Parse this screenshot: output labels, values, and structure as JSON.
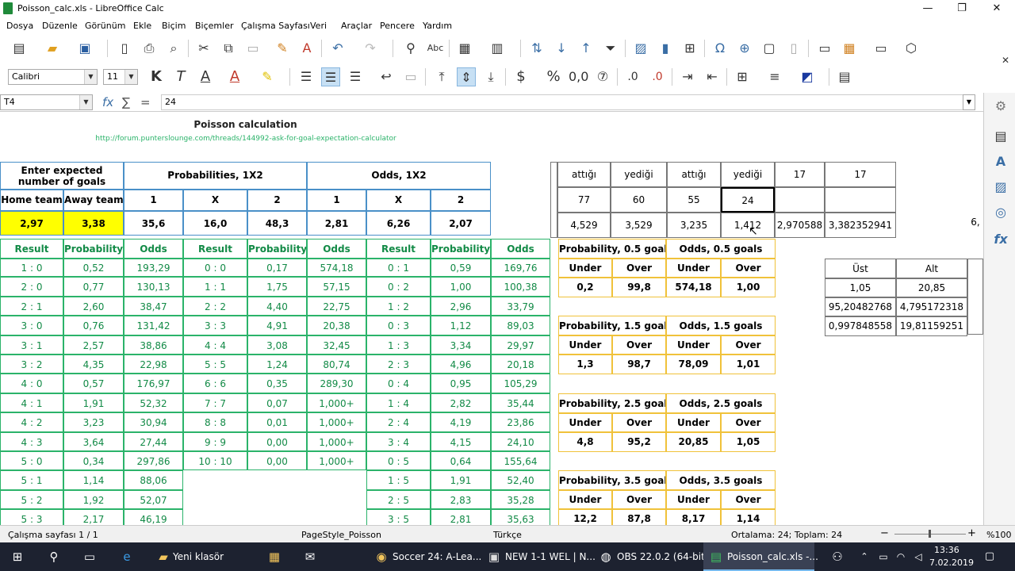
{
  "window": {
    "title": "Poisson_calc.xls - LibreOffice Calc",
    "min": "—",
    "max": "❐",
    "close": "✕"
  },
  "menu": [
    "Dosya",
    "Düzenle",
    "Görünüm",
    "Ekle",
    "Biçim",
    "Biçemler",
    "Çalışma Sayfası",
    "Veri",
    "Araçlar",
    "Pencere",
    "Yardım"
  ],
  "toolbar": {
    "font_name": "Calibri",
    "font_size": "11"
  },
  "formula": {
    "cell_ref": "T4",
    "fx": "fx",
    "sigma": "∑",
    "equals": "=",
    "content": "24"
  },
  "sheet": {
    "title": "Poisson calculation",
    "link": "http://forum.punterslounge.com/threads/144992-ask-for-goal-expectation-calculator",
    "hdr_expected": "Enter expected number of goals",
    "hdr_probs": "Probabilities, 1X2",
    "hdr_odds": "Odds, 1X2",
    "home_team": "Home team",
    "away_team": "Away team",
    "col_1": "1",
    "col_x": "X",
    "col_2": "2",
    "home_val": "2,97",
    "away_val": "3,38",
    "p1": "35,6",
    "px": "16,0",
    "p2": "48,3",
    "o1": "2,81",
    "ox": "6,26",
    "o2": "2,07",
    "col_result": "Result",
    "col_probability": "Probability",
    "col_odds": "Odds",
    "table_a": [
      [
        "1  :  0",
        "0,52",
        "193,29"
      ],
      [
        "2  :  0",
        "0,77",
        "130,13"
      ],
      [
        "2  :  1",
        "2,60",
        "38,47"
      ],
      [
        "3  :  0",
        "0,76",
        "131,42"
      ],
      [
        "3  :  1",
        "2,57",
        "38,86"
      ],
      [
        "3  :  2",
        "4,35",
        "22,98"
      ],
      [
        "4  :  0",
        "0,57",
        "176,97"
      ],
      [
        "4  :  1",
        "1,91",
        "52,32"
      ],
      [
        "4  :  2",
        "3,23",
        "30,94"
      ],
      [
        "4  :  3",
        "3,64",
        "27,44"
      ],
      [
        "5  :  0",
        "0,34",
        "297,86"
      ],
      [
        "5  :  1",
        "1,14",
        "88,06"
      ],
      [
        "5  :  2",
        "1,92",
        "52,07"
      ],
      [
        "5  :  3",
        "2,17",
        "46,19"
      ]
    ],
    "table_b": [
      [
        "0  :  0",
        "0,17",
        "574,18"
      ],
      [
        "1  :  1",
        "1,75",
        "57,15"
      ],
      [
        "2  :  2",
        "4,40",
        "22,75"
      ],
      [
        "3  :  3",
        "4,91",
        "20,38"
      ],
      [
        "4  :  4",
        "3,08",
        "32,45"
      ],
      [
        "5  :  5",
        "1,24",
        "80,74"
      ],
      [
        "6  :  6",
        "0,35",
        "289,30"
      ],
      [
        "7  :  7",
        "0,07",
        "1,000+"
      ],
      [
        "8  :  8",
        "0,01",
        "1,000+"
      ],
      [
        "9  :  9",
        "0,00",
        "1,000+"
      ],
      [
        "10  :  10",
        "0,00",
        "1,000+"
      ]
    ],
    "table_c": [
      [
        "0  :  1",
        "0,59",
        "169,76"
      ],
      [
        "0  :  2",
        "1,00",
        "100,38"
      ],
      [
        "1  :  2",
        "2,96",
        "33,79"
      ],
      [
        "0  :  3",
        "1,12",
        "89,03"
      ],
      [
        "1  :  3",
        "3,34",
        "29,97"
      ],
      [
        "2  :  3",
        "4,96",
        "20,18"
      ],
      [
        "0  :  4",
        "0,95",
        "105,29"
      ],
      [
        "1  :  4",
        "2,82",
        "35,44"
      ],
      [
        "2  :  4",
        "4,19",
        "23,86"
      ],
      [
        "3  :  4",
        "4,15",
        "24,10"
      ],
      [
        "0  :  5",
        "0,64",
        "155,64"
      ],
      [
        "1  :  5",
        "1,91",
        "52,40"
      ],
      [
        "2  :  5",
        "2,83",
        "35,28"
      ],
      [
        "3  :  5",
        "2,81",
        "35,63"
      ]
    ],
    "goals_blocks": [
      {
        "prob_label": "Probability, 0.5 goals",
        "odds_label": "Odds, 0.5 goals",
        "under": "Under",
        "over": "Over",
        "vals": [
          "0,2",
          "99,8",
          "574,18",
          "1,00"
        ]
      },
      {
        "prob_label": "Probability, 1.5 goals",
        "odds_label": "Odds, 1.5 goals",
        "under": "Under",
        "over": "Over",
        "vals": [
          "1,3",
          "98,7",
          "78,09",
          "1,01"
        ]
      },
      {
        "prob_label": "Probability, 2.5 goals",
        "odds_label": "Odds, 2.5 goals",
        "under": "Under",
        "over": "Over",
        "vals": [
          "4,8",
          "95,2",
          "20,85",
          "1,05"
        ]
      },
      {
        "prob_label": "Probability, 3.5 goals",
        "odds_label": "Odds, 3.5 goals",
        "under": "Under",
        "over": "Over",
        "vals": [
          "12,2",
          "87,8",
          "8,17",
          "1,14"
        ]
      }
    ],
    "side_table": {
      "row1": [
        "attığı",
        "yediği",
        "attığı",
        "yediği",
        "17",
        "17"
      ],
      "row2": [
        "77",
        "60",
        "55",
        "24",
        "",
        ""
      ],
      "row3": [
        "4,529",
        "3,529",
        "3,235",
        "1,412",
        "2,970588",
        "3,382352941"
      ],
      "overflow": "6,"
    },
    "ust_alt": {
      "hdr": [
        "Üst",
        "Alt"
      ],
      "rows": [
        [
          "1,05",
          "20,85"
        ],
        [
          "95,20482768",
          "4,795172318"
        ],
        [
          "0,997848558",
          "19,81159251"
        ]
      ]
    }
  },
  "status": {
    "sheet": "Çalışma sayfası 1 / 1",
    "pagestyle": "PageStyle_Poisson",
    "lang": "Türkçe",
    "summary": "Ortalama: 24; Toplam: 24",
    "zoom": "%100"
  },
  "taskbar": {
    "items": [
      "Yeni klasör",
      "Soccer 24: A-Lea...",
      "NEW 1-1 WEL | N...",
      "OBS 22.0.2 (64-bit...",
      "Poisson_calc.xls -..."
    ],
    "time": "13:36",
    "date": "7.02.2019"
  }
}
